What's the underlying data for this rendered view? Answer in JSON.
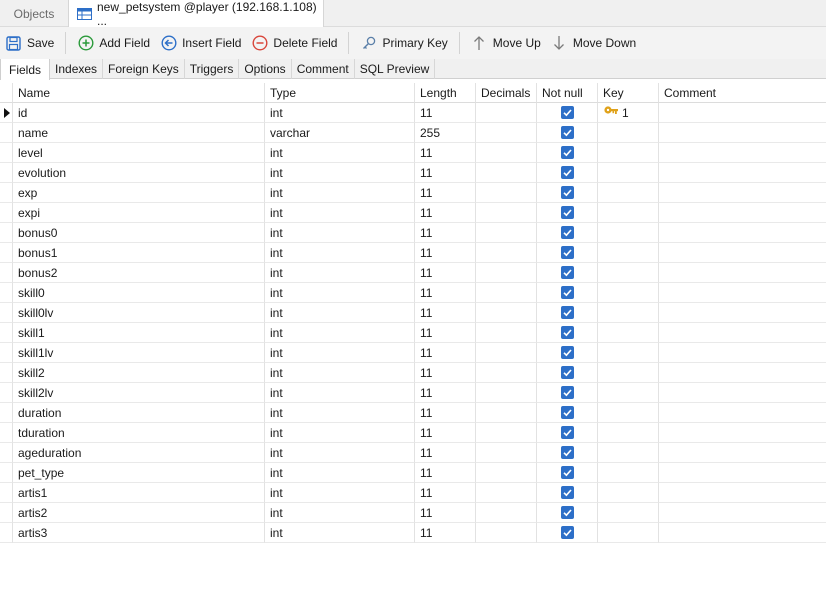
{
  "doc_tabs": {
    "objects": "Objects",
    "active": "new_petsystem @player (192.168.1.108) ..."
  },
  "toolbar": {
    "save": "Save",
    "add_field": "Add Field",
    "insert_field": "Insert Field",
    "delete_field": "Delete Field",
    "primary_key": "Primary Key",
    "move_up": "Move Up",
    "move_down": "Move Down"
  },
  "sub_tabs": [
    "Fields",
    "Indexes",
    "Foreign Keys",
    "Triggers",
    "Options",
    "Comment",
    "SQL Preview"
  ],
  "columns": {
    "name": "Name",
    "type": "Type",
    "length": "Length",
    "decimals": "Decimals",
    "not_null": "Not null",
    "key": "Key",
    "comment": "Comment"
  },
  "rows": [
    {
      "name": "id",
      "type": "int",
      "length": "11",
      "decimals": "",
      "not_null": true,
      "key": "1",
      "comment": ""
    },
    {
      "name": "name",
      "type": "varchar",
      "length": "255",
      "decimals": "",
      "not_null": true,
      "key": "",
      "comment": ""
    },
    {
      "name": "level",
      "type": "int",
      "length": "11",
      "decimals": "",
      "not_null": true,
      "key": "",
      "comment": ""
    },
    {
      "name": "evolution",
      "type": "int",
      "length": "11",
      "decimals": "",
      "not_null": true,
      "key": "",
      "comment": ""
    },
    {
      "name": "exp",
      "type": "int",
      "length": "11",
      "decimals": "",
      "not_null": true,
      "key": "",
      "comment": ""
    },
    {
      "name": "expi",
      "type": "int",
      "length": "11",
      "decimals": "",
      "not_null": true,
      "key": "",
      "comment": ""
    },
    {
      "name": "bonus0",
      "type": "int",
      "length": "11",
      "decimals": "",
      "not_null": true,
      "key": "",
      "comment": ""
    },
    {
      "name": "bonus1",
      "type": "int",
      "length": "11",
      "decimals": "",
      "not_null": true,
      "key": "",
      "comment": ""
    },
    {
      "name": "bonus2",
      "type": "int",
      "length": "11",
      "decimals": "",
      "not_null": true,
      "key": "",
      "comment": ""
    },
    {
      "name": "skill0",
      "type": "int",
      "length": "11",
      "decimals": "",
      "not_null": true,
      "key": "",
      "comment": ""
    },
    {
      "name": "skill0lv",
      "type": "int",
      "length": "11",
      "decimals": "",
      "not_null": true,
      "key": "",
      "comment": ""
    },
    {
      "name": "skill1",
      "type": "int",
      "length": "11",
      "decimals": "",
      "not_null": true,
      "key": "",
      "comment": ""
    },
    {
      "name": "skill1lv",
      "type": "int",
      "length": "11",
      "decimals": "",
      "not_null": true,
      "key": "",
      "comment": ""
    },
    {
      "name": "skill2",
      "type": "int",
      "length": "11",
      "decimals": "",
      "not_null": true,
      "key": "",
      "comment": ""
    },
    {
      "name": "skill2lv",
      "type": "int",
      "length": "11",
      "decimals": "",
      "not_null": true,
      "key": "",
      "comment": ""
    },
    {
      "name": "duration",
      "type": "int",
      "length": "11",
      "decimals": "",
      "not_null": true,
      "key": "",
      "comment": ""
    },
    {
      "name": "tduration",
      "type": "int",
      "length": "11",
      "decimals": "",
      "not_null": true,
      "key": "",
      "comment": ""
    },
    {
      "name": "ageduration",
      "type": "int",
      "length": "11",
      "decimals": "",
      "not_null": true,
      "key": "",
      "comment": ""
    },
    {
      "name": "pet_type",
      "type": "int",
      "length": "11",
      "decimals": "",
      "not_null": true,
      "key": "",
      "comment": ""
    },
    {
      "name": "artis1",
      "type": "int",
      "length": "11",
      "decimals": "",
      "not_null": true,
      "key": "",
      "comment": ""
    },
    {
      "name": "artis2",
      "type": "int",
      "length": "11",
      "decimals": "",
      "not_null": true,
      "key": "",
      "comment": ""
    },
    {
      "name": "artis3",
      "type": "int",
      "length": "11",
      "decimals": "",
      "not_null": true,
      "key": "",
      "comment": ""
    }
  ],
  "colors": {
    "checkbox": "#2d6fc8",
    "add_icon": "#2a9a3a",
    "insert_icon": "#2d6fc8",
    "delete_icon": "#d9463b",
    "key_icon": "#e0a21a"
  },
  "icons": {
    "save": "save-icon",
    "add_field": "add-circle-icon",
    "insert_field": "insert-arrow-circle-icon",
    "delete_field": "minus-circle-icon",
    "primary_key": "key-icon",
    "move_up": "arrow-up-icon",
    "move_down": "arrow-down-icon",
    "table": "table-icon"
  }
}
